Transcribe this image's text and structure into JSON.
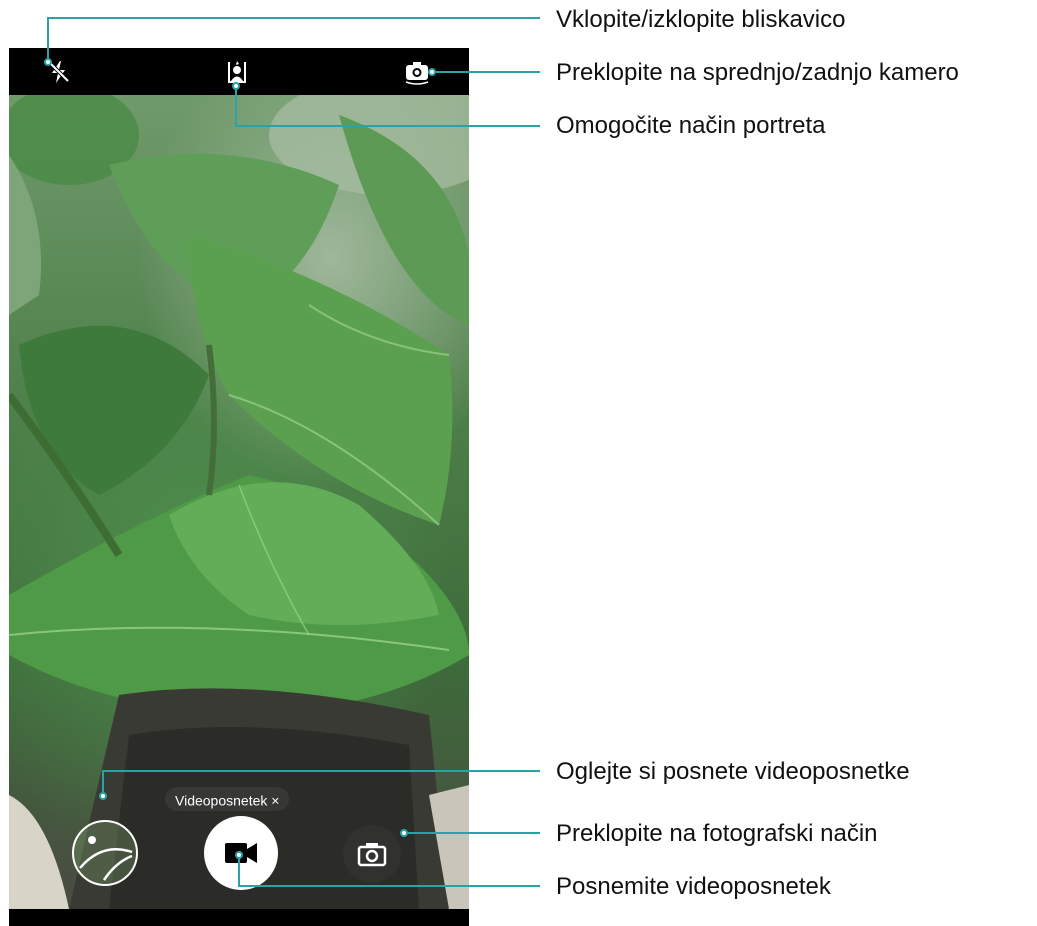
{
  "camera": {
    "mode_chip": {
      "label": "Videoposnetek",
      "close_glyph": "×"
    },
    "icons": {
      "flash": "flash-off-icon",
      "portrait": "portrait-mode-icon",
      "switch_camera": "switch-camera-icon",
      "gallery": "gallery-thumbnail-icon",
      "record": "video-camera-icon",
      "photo": "photo-camera-icon"
    },
    "mode_dots_count": 3,
    "active_dot_index": 1
  },
  "callouts": [
    {
      "id": "flash",
      "text": "Vklopite/izklopite bliskavico"
    },
    {
      "id": "switch",
      "text": "Preklopite na sprednjo/zadnjo kamero"
    },
    {
      "id": "portrait",
      "text": "Omogočite način portreta"
    },
    {
      "id": "gallery",
      "text": "Oglejte si posnete videoposnetke"
    },
    {
      "id": "photo",
      "text": "Preklopite na fotografski način"
    },
    {
      "id": "record",
      "text": "Posnemite videoposnetek"
    }
  ],
  "colors": {
    "callout_line": "#2ba3a6",
    "ui_background": "#000000",
    "icon_color": "#ffffff"
  }
}
